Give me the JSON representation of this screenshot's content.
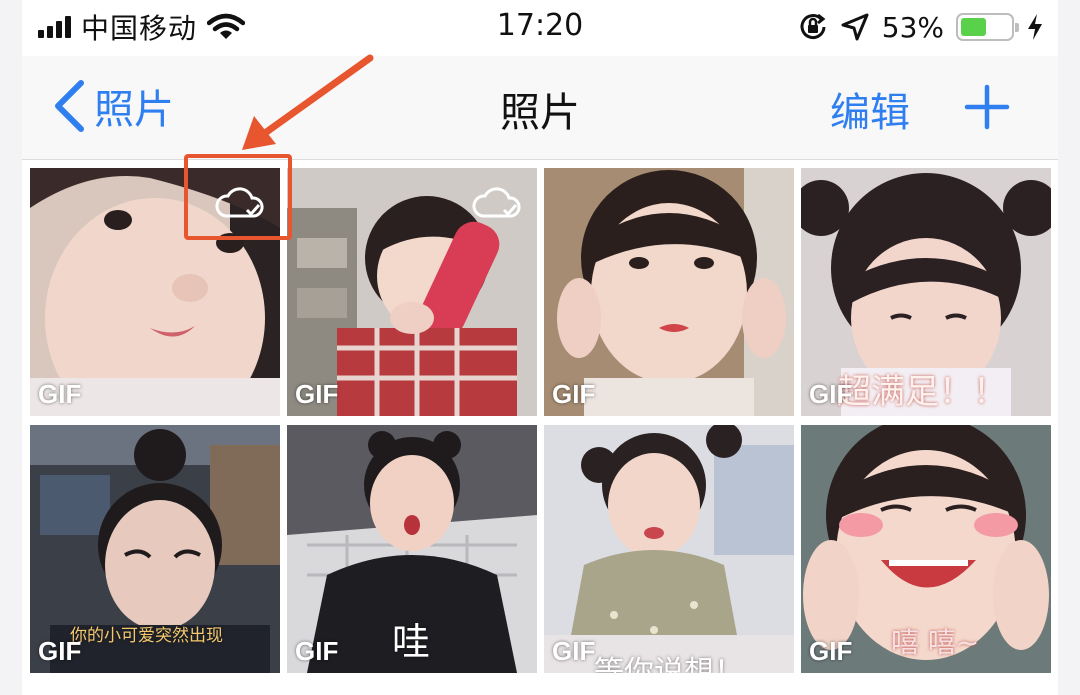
{
  "status_bar": {
    "carrier": "中国移动",
    "time": "17:20",
    "battery_percent": "53%",
    "battery_level": 0.53,
    "icons": [
      "signal-icon",
      "wifi-icon",
      "orientation-lock-icon",
      "location-arrow-icon",
      "battery-icon",
      "charging-bolt-icon"
    ]
  },
  "nav": {
    "back_label": "照片",
    "title": "照片",
    "edit_label": "编辑",
    "add_icon": "plus-icon"
  },
  "grid": {
    "badge": "GIF",
    "items": [
      {
        "badge": "GIF",
        "caption": "",
        "cloud_icon": true
      },
      {
        "badge": "GIF",
        "caption": "",
        "cloud_icon": true
      },
      {
        "badge": "GIF",
        "caption": ""
      },
      {
        "badge": "GIF",
        "caption": "超满足！！"
      },
      {
        "badge": "GIF",
        "caption": "你的小可爱突然出现"
      },
      {
        "badge": "GIF",
        "caption": "哇"
      },
      {
        "badge": "GIF",
        "caption": "等你说想！"
      },
      {
        "badge": "GIF",
        "caption": "嘻 嘻~"
      }
    ]
  },
  "annotation": {
    "color": "#e7562f",
    "target": "cloud-icon"
  },
  "colors": {
    "accent": "#2f7ff0",
    "battery": "#5ad14b",
    "annotation": "#e7562f"
  }
}
